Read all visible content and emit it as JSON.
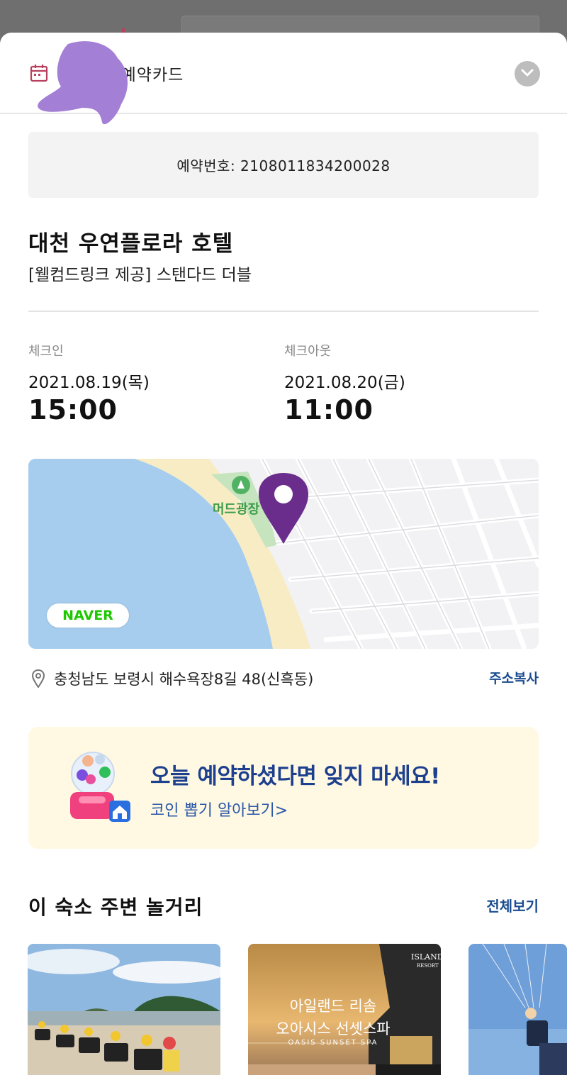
{
  "colors": {
    "accent_blue": "#1a4c8f",
    "naver_green": "#1ec800",
    "pin_purple": "#6b2d8b",
    "promo_bg": "#fff8e2"
  },
  "header": {
    "title": "님의 예약카드",
    "calendar_icon": "calendar-icon",
    "collapse_icon": "chevron-down-icon"
  },
  "booking": {
    "number_text": "예약번호: 2108011834200028"
  },
  "hotel": {
    "name": "대천 우연플로라 호텔",
    "room": "[웰컴드링크 제공] 스탠다드 더블"
  },
  "checkin": {
    "label": "체크인",
    "date": "2021.08.19(목)",
    "time": "15:00"
  },
  "checkout": {
    "label": "체크아웃",
    "date": "2021.08.20(금)",
    "time": "11:00"
  },
  "map": {
    "place_label": "머드광장",
    "badge": "NAVER"
  },
  "address": {
    "text": "충청남도 보령시 해수욕장8길 48(신흑동)",
    "copy_label": "주소복사"
  },
  "promo": {
    "title": "오늘 예약하셨다면 잊지 마세요!",
    "subtitle": "코인 뽑기 알아보기>"
  },
  "nearby": {
    "title": "이 숙소 주변 놀거리",
    "see_all": "전체보기",
    "cards": [
      {
        "caption": ""
      },
      {
        "brand": "ISLAND",
        "brand_sub": "RESORT",
        "caption": "아일랜드 리솜",
        "caption2": "오아시스 선셋스파",
        "caption3": "OASIS SUNSET SPA"
      },
      {
        "caption": ""
      }
    ]
  }
}
